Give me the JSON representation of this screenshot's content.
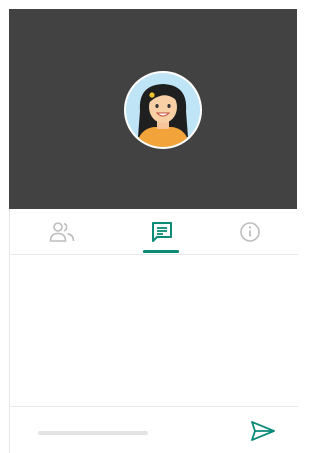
{
  "video": {
    "background_color": "#424242",
    "participant_avatar_icon": "woman-avatar-icon"
  },
  "tabs": [
    {
      "icon": "people-icon",
      "selected": false
    },
    {
      "icon": "chat-icon",
      "selected": true
    },
    {
      "icon": "info-icon",
      "selected": false
    }
  ],
  "composer": {
    "message_value": "",
    "send_icon": "send-icon"
  },
  "colors": {
    "accent": "#0b8a78",
    "inactive_icon": "#bdbdbd",
    "divider": "#e8e8e8"
  }
}
